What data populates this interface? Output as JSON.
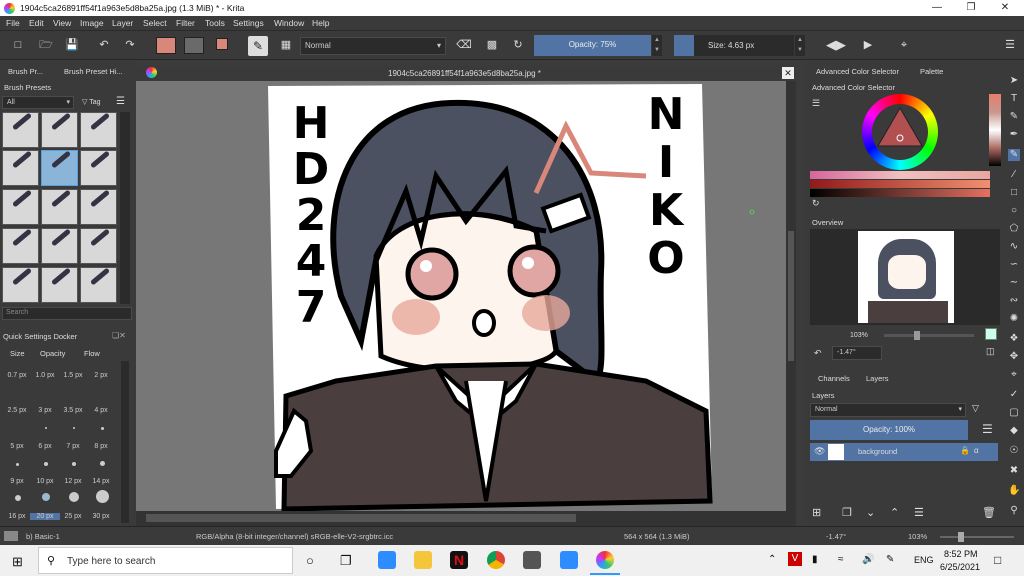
{
  "window": {
    "title": "1904c5ca26891ff54f1a963e5d8ba25a.jpg (1.3 MiB)  * - Krita"
  },
  "menu": [
    "File",
    "Edit",
    "View",
    "Image",
    "Layer",
    "Select",
    "Filter",
    "Tools",
    "Settings",
    "Window",
    "Help"
  ],
  "toolbar": {
    "blend_mode": "Normal",
    "opacity": "Opacity: 75%",
    "size": "Size: 4.63 px",
    "fg_color": "#d9877a",
    "bg_color": "#6a6a6a"
  },
  "left": {
    "tabs": [
      "Brush Pr...",
      "Brush Preset Hi..."
    ],
    "presets_title": "Brush Presets",
    "filter_value": "All",
    "tag_label": "Tag",
    "search_placeholder": "Search",
    "quick_title": "Quick Settings Docker",
    "quick_tabs": [
      "Size",
      "Opacity",
      "Flow"
    ],
    "sizes": [
      "0.7 px",
      "1.0 px",
      "1.5 px",
      "2 px",
      "2.5 px",
      "3 px",
      "3.5 px",
      "4 px",
      "5 px",
      "6 px",
      "7 px",
      "8 px",
      "9 px",
      "10 px",
      "12 px",
      "14 px",
      "16 px",
      "20 px",
      "25 px",
      "30 px"
    ],
    "preset_name": "b) Basic-1"
  },
  "document": {
    "tab_title": "1904c5ca26891ff54f1a963e5d8ba25a.jpg *"
  },
  "artwork": {
    "left_text": [
      "H",
      "D",
      "2",
      "4",
      "7"
    ],
    "right_text": [
      "N",
      "I",
      "K",
      "O"
    ]
  },
  "right": {
    "tabs": [
      "Advanced Color Selector",
      "Palette"
    ],
    "color_title": "Advanced Color Selector",
    "overview_title": "Overview",
    "zoom": "103%",
    "rotation": "-1.47°",
    "layer_tabs": [
      "Channels",
      "Layers"
    ],
    "layers_title": "Layers",
    "blend": "Normal",
    "opacity": "Opacity:  100%",
    "layer_name": "background"
  },
  "status": {
    "colorspace": "RGB/Alpha (8-bit integer/channel)  sRGB-elle-V2-srgbtrc.icc",
    "dims": "564 x 564 (1.3 MiB)",
    "rotation": "-1.47°",
    "zoom": "103%"
  },
  "taskbar": {
    "search_placeholder": "Type here to search",
    "lang": "ENG",
    "time": "8:52 PM",
    "date": "6/25/2021"
  }
}
